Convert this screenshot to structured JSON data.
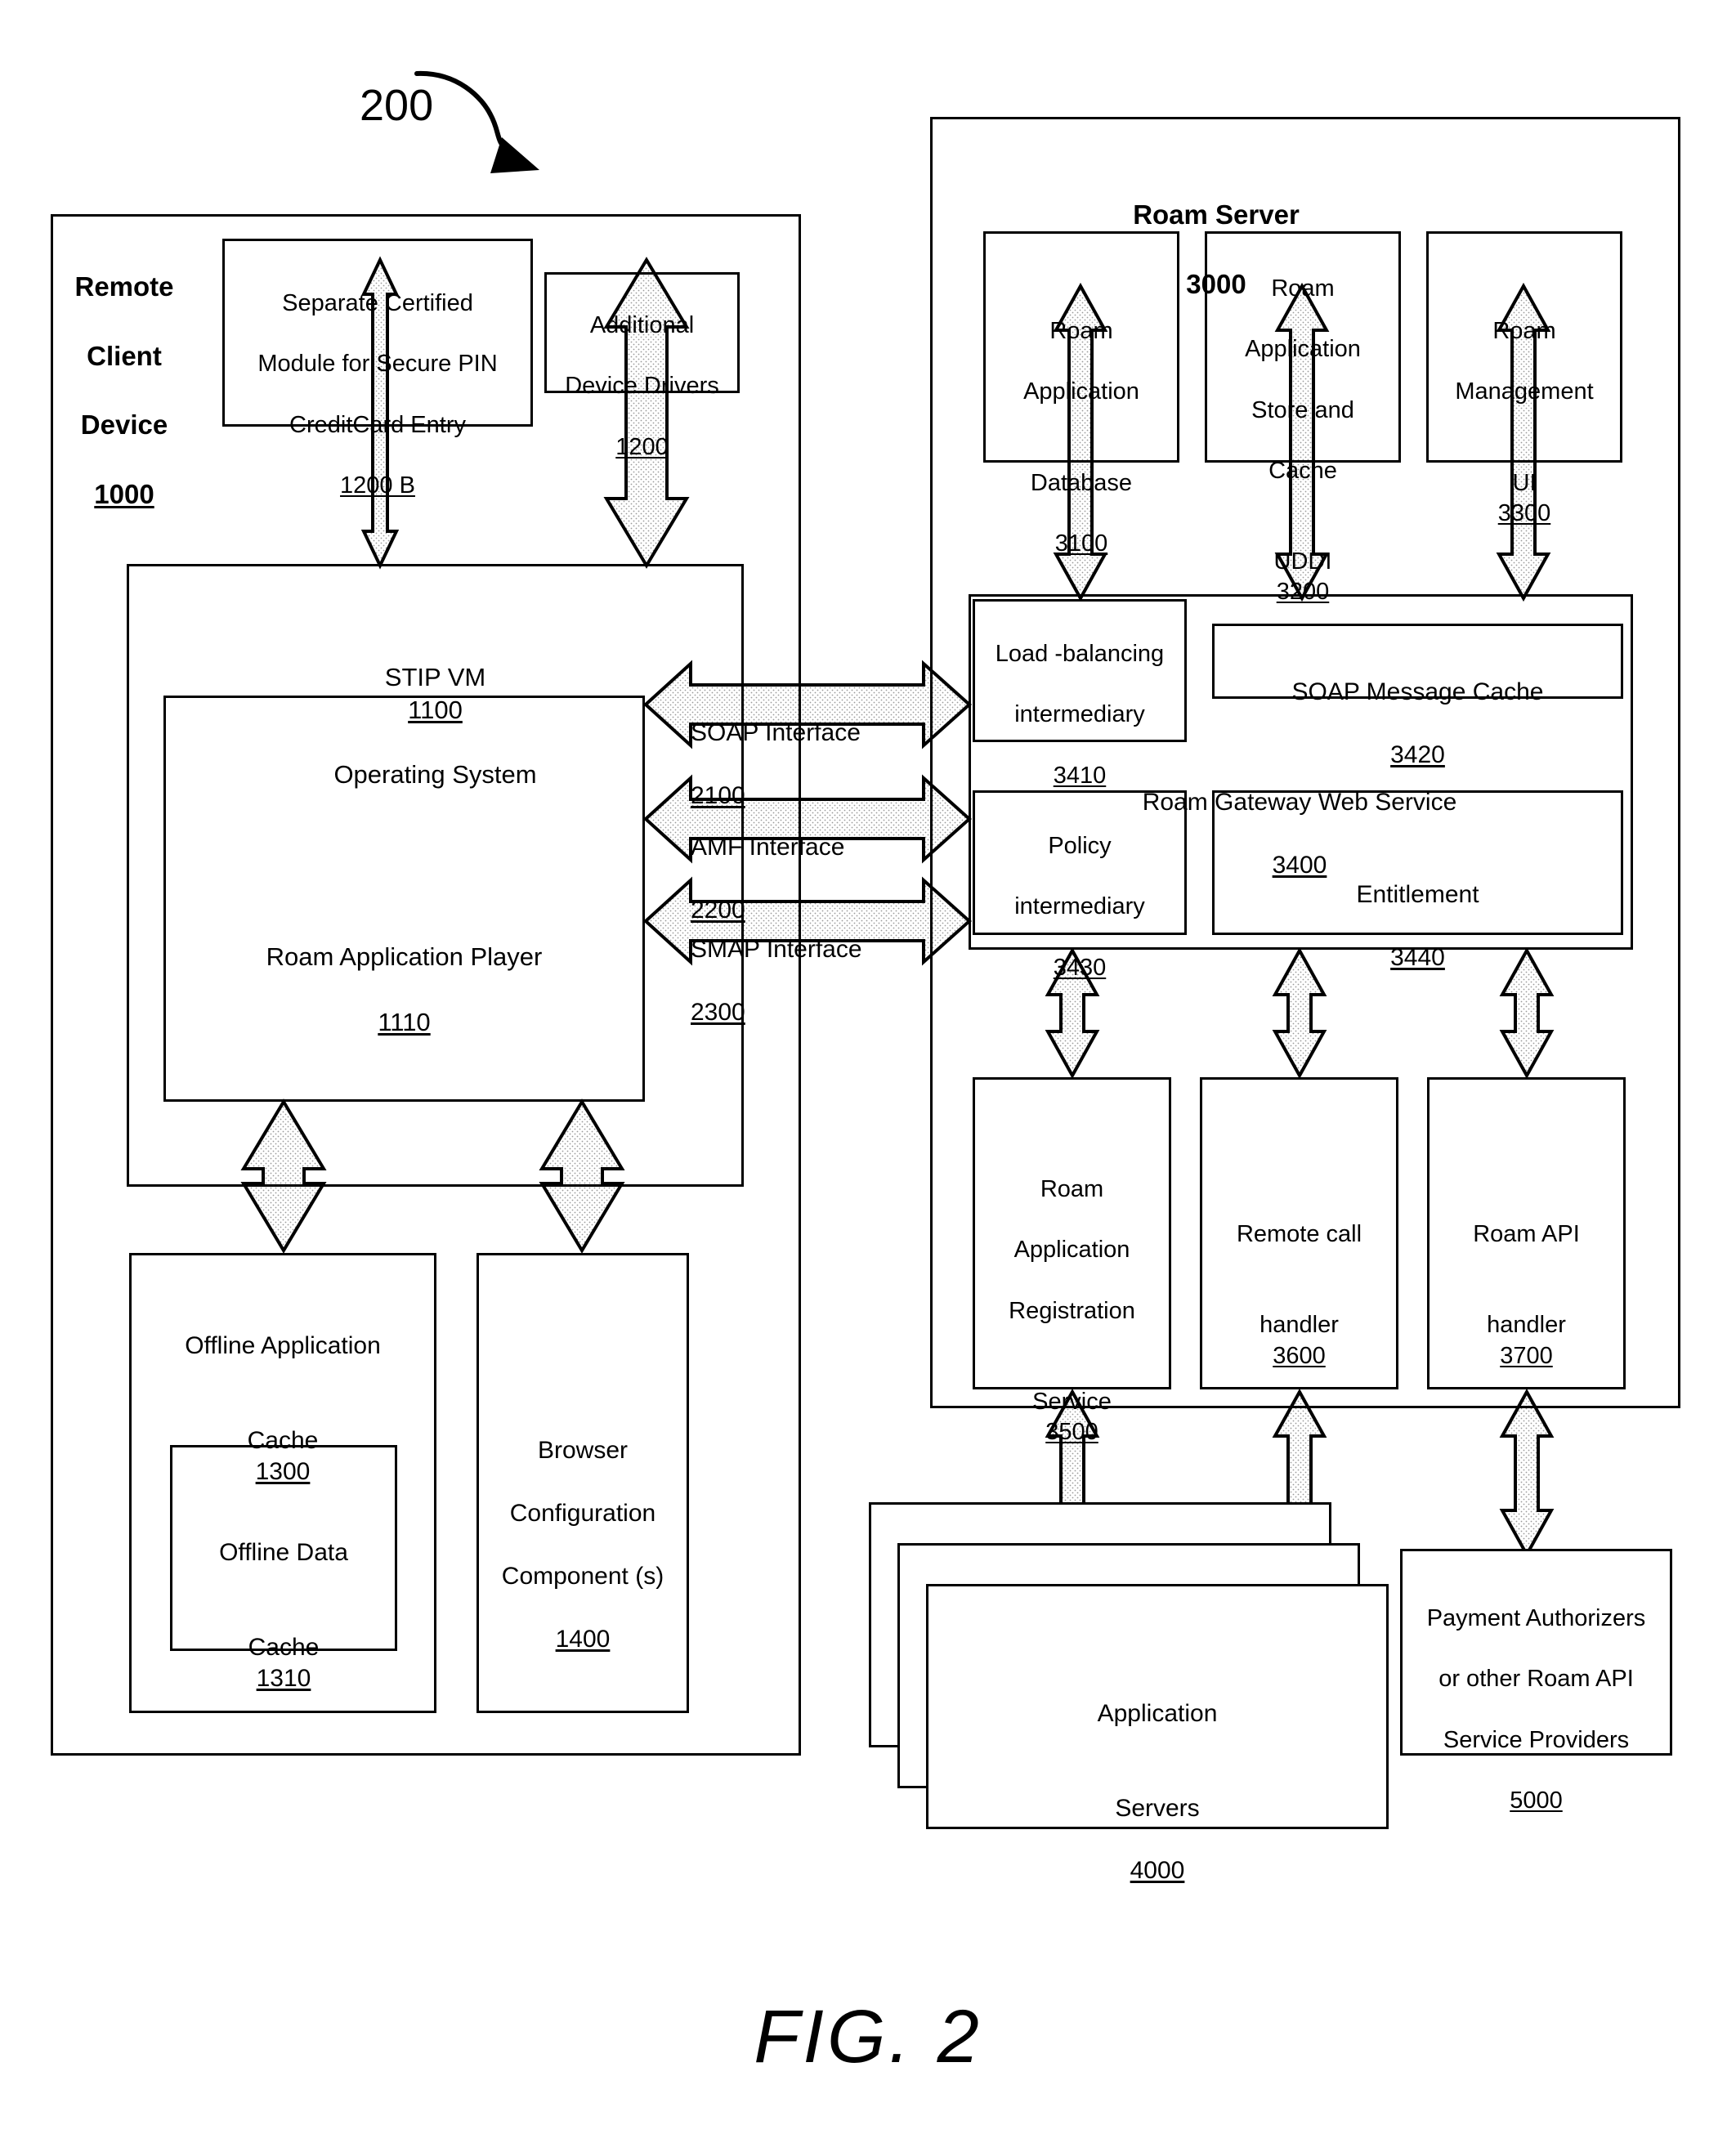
{
  "figure": {
    "number_callout": "200",
    "caption": "FIG. 2"
  },
  "client": {
    "title_line1": "Remote",
    "title_line2": "Client",
    "title_line3": "Device",
    "title_ref": "1000",
    "secure_module": {
      "line1": "Separate Certified",
      "line2": "Module for Secure PIN",
      "line3": "CreditCard Entry",
      "ref": "1200 B"
    },
    "device_drivers": {
      "line1": "Additional",
      "line2": "Device Drivers",
      "ref": "1200"
    },
    "stip_vm": {
      "title": "STIP VM",
      "ref": "1100",
      "subtitle": "Operating System"
    },
    "app_player": {
      "label": "Roam Application Player",
      "ref": "1110"
    },
    "offline_app_cache": {
      "line1": "Offline Application",
      "line2": "Cache",
      "ref": "1300"
    },
    "offline_data_cache": {
      "line1": "Offline Data",
      "line2": "Cache",
      "ref": "1310"
    },
    "browser_config": {
      "line1": "Browser",
      "line2": "Configuration",
      "line3": "Component (s)",
      "ref": "1400"
    }
  },
  "interfaces": [
    {
      "label": "SOAP Interface",
      "ref": "2100"
    },
    {
      "label": "AMF  Interface",
      "ref": "2200"
    },
    {
      "label": "SMAP Interface",
      "ref": "2300"
    }
  ],
  "server": {
    "title": "Roam Server",
    "title_ref": "3000",
    "app_database": {
      "line1": "Roam",
      "line2": "Application",
      "line3": "Database",
      "ref": "3100"
    },
    "app_store_cache": {
      "line1": "Roam",
      "line2": "Application",
      "line3": "Store and",
      "line4": "Cache",
      "line5": "UDDI",
      "ref": "3200"
    },
    "management_ui": {
      "line1": "Roam",
      "line2": "Management",
      "line3": "UI",
      "ref": "3300"
    },
    "gateway": {
      "label": "Roam Gateway Web Service",
      "ref": "3400"
    },
    "load_balancing": {
      "line1": "Load -balancing",
      "line2": "intermediary",
      "ref": "3410"
    },
    "soap_message_cache": {
      "label": "SOAP Message Cache",
      "ref": "3420"
    },
    "policy_intermediary": {
      "line1": "Policy",
      "line2": "intermediary",
      "ref": "3430"
    },
    "entitlement": {
      "label": "Entitlement",
      "ref": "3440"
    },
    "registration_service": {
      "line1": "Roam",
      "line2": "Application",
      "line3": "Registration",
      "line4": "Service",
      "ref": "3500"
    },
    "remote_call_handler": {
      "line1": "Remote call",
      "line2": "handler",
      "ref": "3600"
    },
    "roam_api_handler": {
      "line1": "Roam API",
      "line2": "handler",
      "ref": "3700"
    }
  },
  "external": {
    "application_servers": {
      "line1": "Application",
      "line2": "Servers",
      "ref": "4000"
    },
    "payment_authorizers": {
      "line1": "Payment Authorizers",
      "line2": "or other Roam API",
      "line3": "Service Providers",
      "ref": "5000"
    }
  },
  "colors": {
    "stroke": "#000000",
    "arrow_fill": "#f2f2f2",
    "background": "#ffffff"
  }
}
